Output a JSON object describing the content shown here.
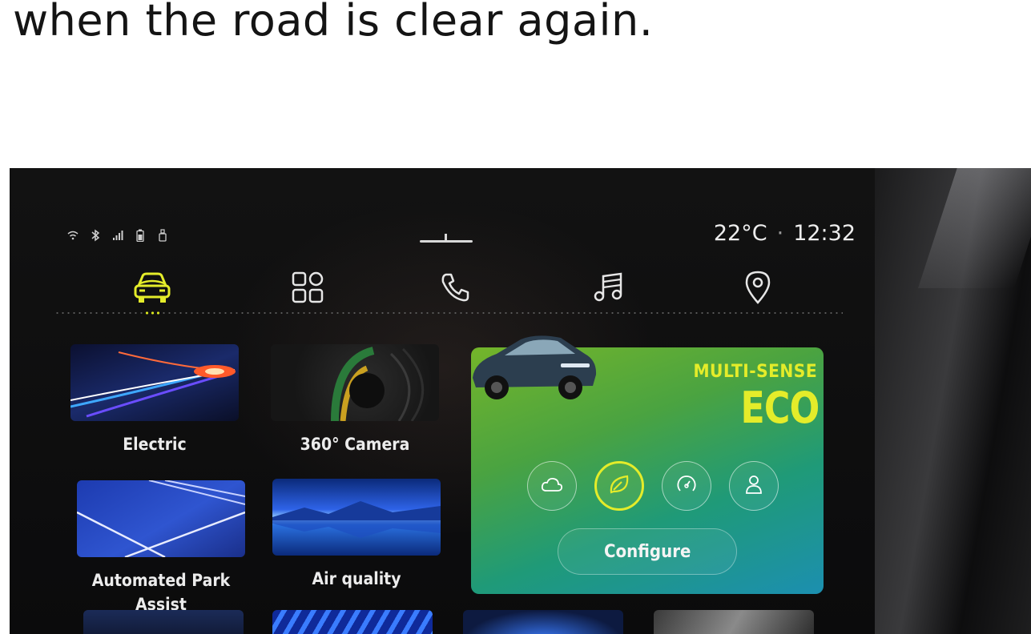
{
  "caption": "when the road is clear again.",
  "status_bar": {
    "icons": [
      "wifi-icon",
      "bluetooth-icon",
      "signal-icon",
      "battery-icon",
      "usb-icon"
    ],
    "temperature": "22°C",
    "separator": "·",
    "time": "12:32"
  },
  "nav": {
    "items": [
      {
        "name": "car-icon",
        "active": true
      },
      {
        "name": "apps-grid-icon",
        "active": false
      },
      {
        "name": "phone-icon",
        "active": false
      },
      {
        "name": "music-icon",
        "active": false
      },
      {
        "name": "location-pin-icon",
        "active": false
      }
    ]
  },
  "tiles": [
    {
      "label": "Electric"
    },
    {
      "label": "360° Camera"
    },
    {
      "label": "Automated Park Assist"
    },
    {
      "label": "Air quality"
    }
  ],
  "eco_card": {
    "title": "MULTI-SENSE",
    "mode": "ECO",
    "modes": [
      {
        "name": "cloud-icon",
        "active": false
      },
      {
        "name": "leaf-icon",
        "active": true
      },
      {
        "name": "speedometer-icon",
        "active": false
      },
      {
        "name": "person-icon",
        "active": false
      }
    ],
    "configure_label": "Configure"
  },
  "colors": {
    "accent": "#E4EC2A",
    "card_gradient_start": "#74B52A",
    "card_gradient_end": "#1C8FB0",
    "screen_background": "#0B0B0C"
  }
}
